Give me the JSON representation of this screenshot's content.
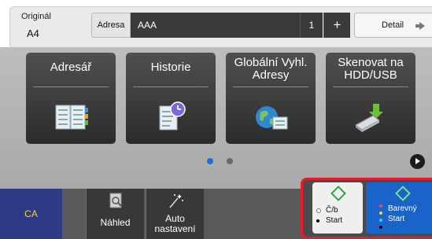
{
  "header": {
    "original_label": "Originál",
    "original_value": "A4",
    "address_button": "Adresa",
    "address_value": "AAA",
    "copies": "1",
    "plus_symbol": "+",
    "detail_button": "Detail"
  },
  "tiles": [
    {
      "label": "Adresář",
      "icon": "address-book-icon"
    },
    {
      "label": "Historie",
      "icon": "history-icon"
    },
    {
      "label": "Globální Vyhl. Adresy",
      "icon": "global-address-icon"
    },
    {
      "label": "Skenovat na HDD/USB",
      "icon": "scan-to-usb-icon"
    }
  ],
  "pager": {
    "pages": 2,
    "current": 1,
    "active_color": "#1f6fd6",
    "inactive_color": "#6a6a6a"
  },
  "bottom": {
    "ca": "CA",
    "preview": "Náhled",
    "auto_settings": "Auto nastavení",
    "bw_start_line1": "Č/b",
    "bw_start_line2": "Start",
    "color_start_line1": "Barevný",
    "color_start_line2": "Start"
  },
  "colors": {
    "ca_background": "#2f3a86",
    "ca_text": "#f2d52b",
    "color_start": "#1a63c9",
    "highlight_frame": "#e8192c",
    "start_diamond": "#2ea24a"
  }
}
